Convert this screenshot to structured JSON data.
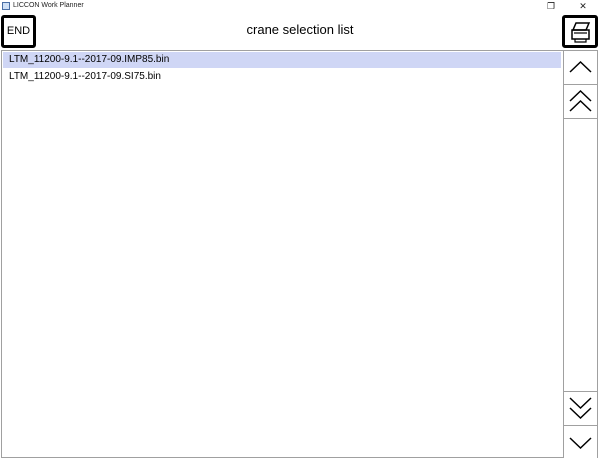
{
  "window": {
    "title": "LICCON Work Planner",
    "restore_glyph": "❐",
    "close_glyph": "✕"
  },
  "header": {
    "end_label": "END",
    "title": "crane selection list"
  },
  "list": {
    "items": [
      {
        "label": "LTM_11200-9.1--2017-09.IMP85.bin",
        "selected": true
      },
      {
        "label": "LTM_11200-9.1--2017-09.SI75.bin",
        "selected": false
      }
    ]
  },
  "colors": {
    "selection": "#cfd6f5",
    "border": "#a0a0a0"
  },
  "icons": {
    "print": "printer-icon",
    "up": "chevron-up-icon",
    "page_up": "double-chevron-up-icon",
    "page_down": "double-chevron-down-icon",
    "down": "chevron-down-icon"
  }
}
